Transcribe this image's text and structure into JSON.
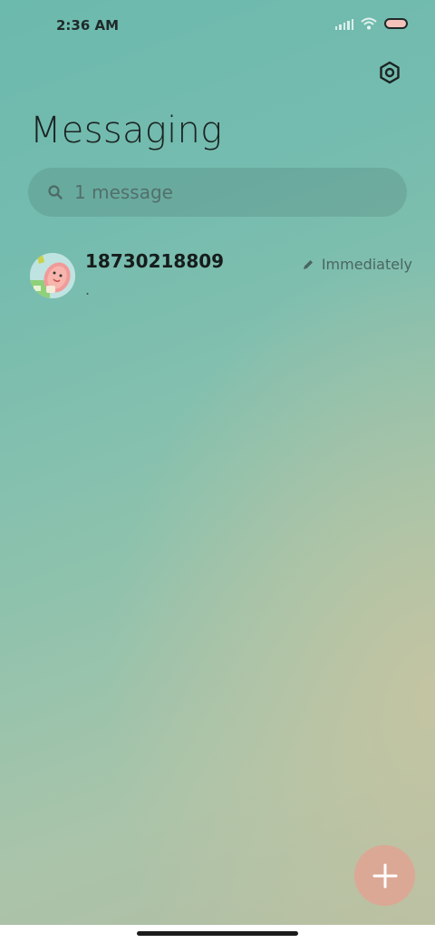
{
  "status_bar": {
    "time": "2:36 AM",
    "icons": [
      "signal-icon",
      "wifi-icon",
      "battery-icon"
    ],
    "battery_color": "#f2c2bb"
  },
  "header": {
    "title": "Messaging",
    "settings_icon": "gear-icon"
  },
  "search": {
    "placeholder": "1 message",
    "icon": "search-icon"
  },
  "conversations": [
    {
      "sender": "18730218809",
      "preview": ".",
      "time": "Immediately",
      "draft_icon": "pencil-icon",
      "avatar": "avatar"
    }
  ],
  "fab": {
    "icon": "plus-icon",
    "color": "#dba896"
  }
}
